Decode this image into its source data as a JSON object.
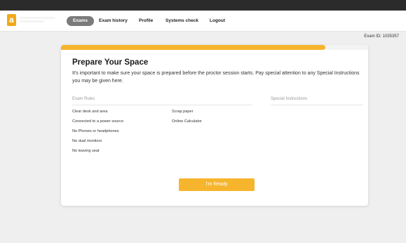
{
  "nav": {
    "items": [
      "Exams",
      "Exam history",
      "Profile",
      "Systems check",
      "Logout"
    ],
    "active": "Exams"
  },
  "exam_id": "Exam ID: 1035357",
  "progress": {
    "fraction": 0.86,
    "color": "#f6b52d"
  },
  "card": {
    "title": "Prepare Your Space",
    "description": "It's important to make sure your space is prepared before the proctor session starts. Pay special attention to any Special Instructions you may be given here.",
    "rules_header": "Exam Rules",
    "special_header": "Special Instructions",
    "rules_col1": [
      "Clear desk and area",
      "Connected to a power source",
      "No Phones or headphones",
      "No dual monitors",
      "No leaving seat"
    ],
    "rules_col2": [
      "Scrap paper",
      "Online Calculator"
    ],
    "ready_button": "I'm Ready"
  },
  "colors": {
    "accent": "#f6b52d",
    "active_nav": "#7b7b7b",
    "topbar": "#2b2b2b"
  }
}
